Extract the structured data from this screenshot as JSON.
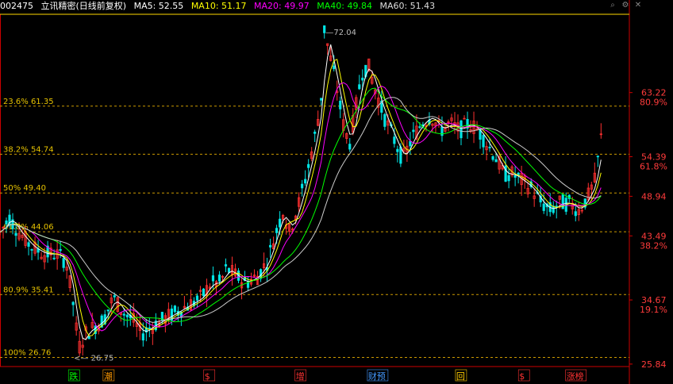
{
  "header": {
    "code": "002475",
    "name": "立讯精密(日线前复权)",
    "ma": [
      {
        "label": "MA5: 52.55",
        "color": "#ffffff"
      },
      {
        "label": "MA10: 51.17",
        "color": "#ffff00"
      },
      {
        "label": "MA20: 49.97",
        "color": "#ff00ff"
      },
      {
        "label": "MA40: 49.84",
        "color": "#00ff00"
      },
      {
        "label": "MA60: 51.43",
        "color": "#dddddd"
      }
    ],
    "icons": [
      "search-icon",
      "settings-icon",
      "close-icon"
    ]
  },
  "chart_data": {
    "type": "candlestick",
    "ylim": [
      25.5,
      74
    ],
    "price_axis": [
      {
        "value": 63.22,
        "label": "63.22",
        "pct": "80.9%"
      },
      {
        "value": 54.39,
        "label": "54.39",
        "pct": "61.8%"
      },
      {
        "value": 48.94,
        "label": "48.94",
        "pct": ""
      },
      {
        "value": 43.49,
        "label": "43.49",
        "pct": "38.2%"
      },
      {
        "value": 34.67,
        "label": "34.67",
        "pct": "19.1%"
      },
      {
        "value": 25.84,
        "label": "25.84",
        "pct": ""
      }
    ],
    "fib_levels": [
      {
        "label": "23.6% 61.35",
        "value": 61.35
      },
      {
        "label": "38.2% 54.74",
        "value": 54.74
      },
      {
        "label": "50% 49.40",
        "value": 49.4
      },
      {
        "label": "61.8% 44.06",
        "value": 44.06
      },
      {
        "label": "80.9% 35.41",
        "value": 35.41
      },
      {
        "label": "100% 26.76",
        "value": 26.76
      }
    ],
    "high_label": {
      "text": "72.04",
      "value": 72.04
    },
    "low_label": {
      "text": "26.75",
      "value": 26.75
    },
    "events": [
      {
        "text": "跌",
        "color": "#00ff00",
        "pos": 0.11
      },
      {
        "text": "潮",
        "color": "#ff9900",
        "pos": 0.165
      },
      {
        "text": "$",
        "color": "#ff3333",
        "pos": 0.325
      },
      {
        "text": "增",
        "color": "#ff3333",
        "pos": 0.47
      },
      {
        "text": "财预",
        "color": "#4499ff",
        "pos": 0.585
      },
      {
        "text": "回",
        "color": "#ffcc00",
        "pos": 0.725
      },
      {
        "text": "$",
        "color": "#ff3333",
        "pos": 0.825
      },
      {
        "text": "涨榜",
        "color": "#ff3333",
        "pos": 0.9
      }
    ],
    "price_path": [
      [
        0,
        44
      ],
      [
        0.015,
        46
      ],
      [
        0.03,
        44
      ],
      [
        0.05,
        42
      ],
      [
        0.07,
        41
      ],
      [
        0.09,
        41
      ],
      [
        0.105,
        40
      ],
      [
        0.115,
        35
      ],
      [
        0.125,
        28
      ],
      [
        0.135,
        30
      ],
      [
        0.15,
        31
      ],
      [
        0.165,
        32
      ],
      [
        0.18,
        35
      ],
      [
        0.195,
        33
      ],
      [
        0.21,
        32
      ],
      [
        0.225,
        30
      ],
      [
        0.24,
        31
      ],
      [
        0.26,
        32
      ],
      [
        0.28,
        33
      ],
      [
        0.3,
        34
      ],
      [
        0.32,
        35
      ],
      [
        0.335,
        37
      ],
      [
        0.35,
        37
      ],
      [
        0.36,
        39
      ],
      [
        0.375,
        38
      ],
      [
        0.39,
        37
      ],
      [
        0.41,
        38
      ],
      [
        0.425,
        40
      ],
      [
        0.435,
        43
      ],
      [
        0.45,
        47
      ],
      [
        0.46,
        44
      ],
      [
        0.475,
        48
      ],
      [
        0.49,
        53
      ],
      [
        0.5,
        57
      ],
      [
        0.51,
        62
      ],
      [
        0.515,
        72.04
      ],
      [
        0.525,
        68
      ],
      [
        0.535,
        64
      ],
      [
        0.545,
        59
      ],
      [
        0.555,
        56
      ],
      [
        0.565,
        61
      ],
      [
        0.575,
        66
      ],
      [
        0.585,
        67
      ],
      [
        0.595,
        64
      ],
      [
        0.61,
        60
      ],
      [
        0.625,
        57
      ],
      [
        0.64,
        54
      ],
      [
        0.655,
        57
      ],
      [
        0.67,
        59
      ],
      [
        0.685,
        60
      ],
      [
        0.7,
        58
      ],
      [
        0.715,
        59
      ],
      [
        0.73,
        58
      ],
      [
        0.745,
        59
      ],
      [
        0.76,
        58
      ],
      [
        0.775,
        56
      ],
      [
        0.79,
        54
      ],
      [
        0.8,
        52
      ],
      [
        0.815,
        52
      ],
      [
        0.83,
        51
      ],
      [
        0.845,
        50
      ],
      [
        0.86,
        48
      ],
      [
        0.875,
        47
      ],
      [
        0.89,
        48
      ],
      [
        0.905,
        48
      ],
      [
        0.92,
        47
      ],
      [
        0.935,
        49
      ],
      [
        0.945,
        51
      ],
      [
        0.955,
        57
      ]
    ],
    "ma_series": [
      {
        "name": "MA5",
        "color": "#ffffff",
        "smooth": 2
      },
      {
        "name": "MA10",
        "color": "#ffff00",
        "smooth": 4
      },
      {
        "name": "MA20",
        "color": "#ff00ff",
        "smooth": 8
      },
      {
        "name": "MA40",
        "color": "#00ff00",
        "smooth": 16
      },
      {
        "name": "MA60",
        "color": "#cccccc",
        "smooth": 24
      }
    ]
  }
}
